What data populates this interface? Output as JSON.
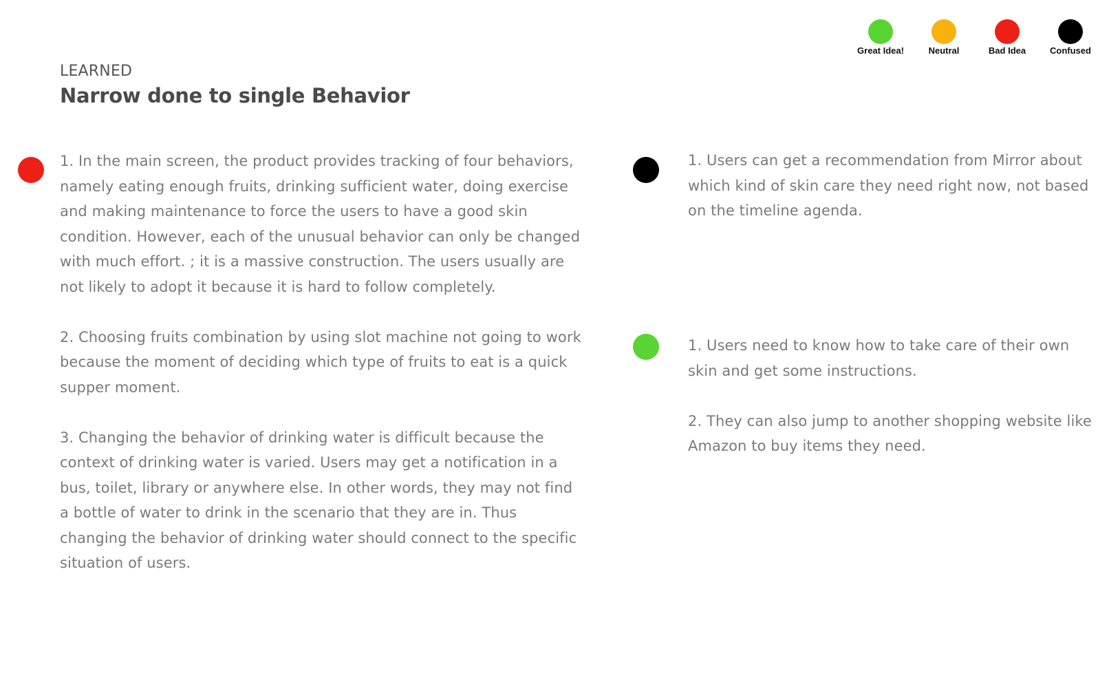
{
  "legend": [
    {
      "label": "Great Idea!",
      "color": "#5ad432"
    },
    {
      "label": "Neutral",
      "color": "#f8b10d"
    },
    {
      "label": "Bad Idea",
      "color": "#ec2016"
    },
    {
      "label": "Confused",
      "color": "#000000"
    }
  ],
  "header": {
    "section_label": "LEARNED",
    "title": "Narrow done to single Behavior"
  },
  "left_column": {
    "marker_color": "#ec2016",
    "notes": [
      "1. In the main screen, the product provides tracking of four behaviors, namely eating enough fruits, drinking sufficient water, doing exercise and making maintenance to force the users to have a good skin condition. However, each of the unusual behavior can only be changed with much effort. ; it is a massive construction. The users usually are not likely to adopt it because it is hard to follow completely.",
      "2. Choosing fruits combination by using slot machine not going to work because the moment of deciding which type of fruits to eat is a quick supper moment.",
      "3. Changing the behavior of drinking water is difficult because the context of drinking water is varied. Users may get a notification in a bus, toilet, library or anywhere else. In other words,  they may not find a bottle of water to drink in the scenario that they are in. Thus changing the behavior of drinking water should connect to the specific situation of users."
    ]
  },
  "right_column": {
    "group_1": {
      "marker_color": "#000000",
      "notes": [
        "1. Users can get a recommendation from Mirror about which kind of skin care they need right now, not based on the timeline agenda."
      ]
    },
    "group_2": {
      "marker_color": "#5ad432",
      "notes": [
        "1. Users need to know how to take care of their own skin and get some instructions.",
        "2. They can also jump to another shopping website like Amazon to buy items they need."
      ]
    }
  }
}
